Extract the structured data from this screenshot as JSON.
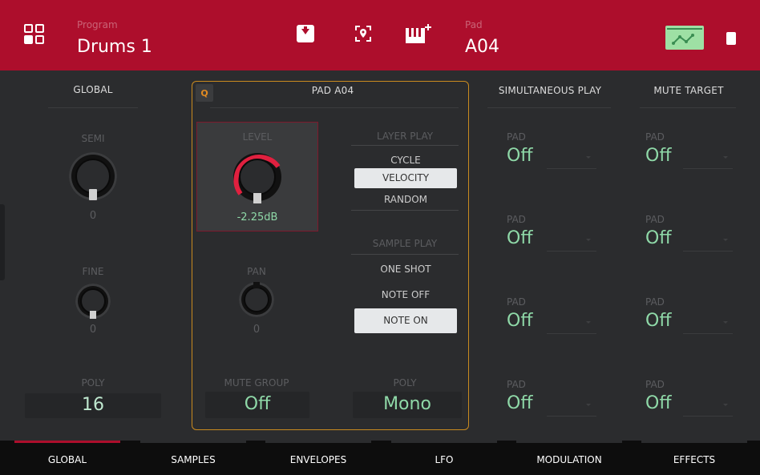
{
  "header": {
    "program_label": "Program",
    "program_name": "Drums 1",
    "pad_label": "Pad",
    "pad_name": "A04"
  },
  "global": {
    "title": "GLOBAL",
    "semi_label": "SEMI",
    "semi_value": "0",
    "fine_label": "FINE",
    "fine_value": "0",
    "poly_label": "POLY",
    "poly_value": "16"
  },
  "pad": {
    "q_label": "Q",
    "title": "PAD A04",
    "level_label": "LEVEL",
    "level_value": "-2.25dB",
    "pan_label": "PAN",
    "pan_value": "0",
    "layer_play_label": "LAYER PLAY",
    "layer_options": [
      "CYCLE",
      "VELOCITY",
      "RANDOM"
    ],
    "layer_selected": "VELOCITY",
    "sample_play_label": "SAMPLE PLAY",
    "sample_options": [
      "ONE SHOT",
      "NOTE OFF",
      "NOTE ON"
    ],
    "sample_selected": "NOTE ON",
    "mute_group_label": "MUTE GROUP",
    "mute_group_value": "Off",
    "poly_label": "POLY",
    "poly_value": "Mono"
  },
  "simultaneous": {
    "title": "SIMULTANEOUS PLAY",
    "items": [
      {
        "label": "PAD",
        "value": "Off"
      },
      {
        "label": "PAD",
        "value": "Off"
      },
      {
        "label": "PAD",
        "value": "Off"
      },
      {
        "label": "PAD",
        "value": "Off"
      }
    ]
  },
  "mute_target": {
    "title": "MUTE TARGET",
    "items": [
      {
        "label": "PAD",
        "value": "Off"
      },
      {
        "label": "PAD",
        "value": "Off"
      },
      {
        "label": "PAD",
        "value": "Off"
      },
      {
        "label": "PAD",
        "value": "Off"
      }
    ]
  },
  "tabs": [
    "GLOBAL",
    "SAMPLES",
    "ENVELOPES",
    "LFO",
    "MODULATION",
    "EFFECTS"
  ],
  "active_tab": "GLOBAL",
  "colors": {
    "header": "#ad0e2c",
    "accent_green": "#8fd9a8",
    "pad_border": "#c98a1f",
    "knob_active": "#e0203f"
  },
  "icons": {
    "menu": "grid-icon",
    "save": "download-icon",
    "locate": "locate-icon",
    "keyboard": "keyboard-add-icon",
    "automation": "waveform-icon",
    "device": "chip-icon"
  }
}
